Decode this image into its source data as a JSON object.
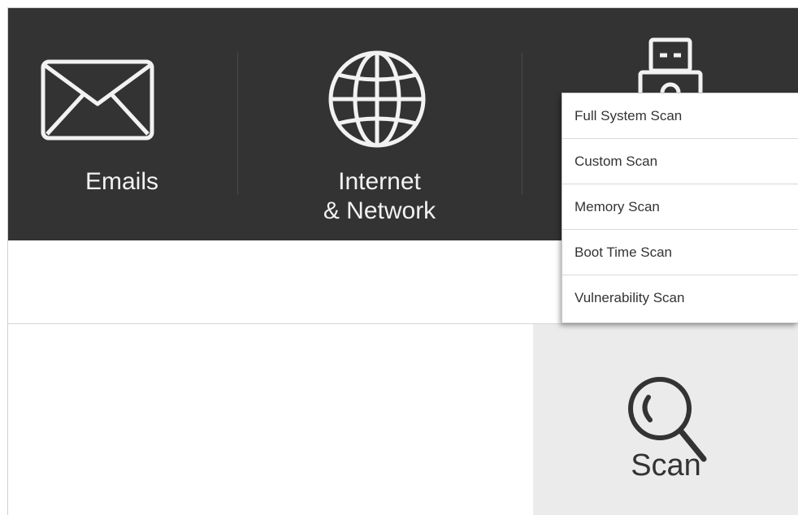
{
  "tiles": [
    {
      "label": "Emails",
      "icon": "envelope-icon"
    },
    {
      "label": "Internet\n& Network",
      "icon": "globe-icon"
    },
    {
      "label": "",
      "icon": "usb-drive-icon"
    }
  ],
  "scan": {
    "label": "Scan",
    "icon": "search-icon"
  },
  "scan_menu": {
    "items": [
      {
        "label": "Full System Scan"
      },
      {
        "label": "Custom Scan"
      },
      {
        "label": "Memory Scan"
      },
      {
        "label": "Boot Time Scan"
      },
      {
        "label": "Vulnerability Scan"
      }
    ]
  },
  "colors": {
    "topbar": "#333333",
    "tile_text": "#f2f2f2",
    "scan_panel": "#ebebeb",
    "menu_bg": "#ffffff"
  }
}
